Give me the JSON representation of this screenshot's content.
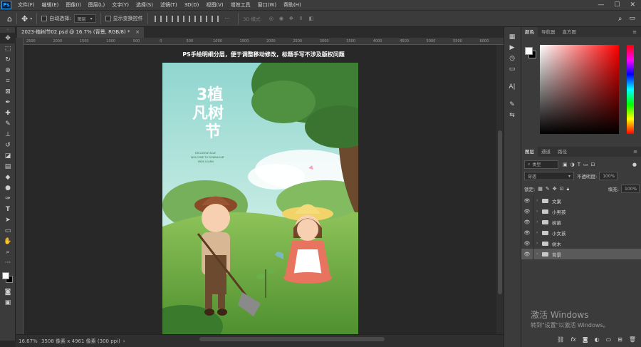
{
  "app": {
    "logo": "Ps"
  },
  "menu": [
    "文件(F)",
    "编辑(E)",
    "图像(I)",
    "图层(L)",
    "文字(Y)",
    "选择(S)",
    "滤镜(T)",
    "3D(D)",
    "视图(V)",
    "增效工具",
    "窗口(W)",
    "帮助(H)"
  ],
  "window_controls": {
    "minimize": "—",
    "maximize": "☐",
    "close": "✕"
  },
  "options_bar": {
    "auto_select_label": "自动选择:",
    "auto_select_value": "图层",
    "show_transform_label": "显示变换控件",
    "mode_3d_label": "3D 模式:"
  },
  "document_tab": {
    "title": "2023-植树节02.psd @ 16.7% (背景, RGB/8) *",
    "close": "×"
  },
  "ruler": {
    "top_ticks": [
      "2500",
      "2000",
      "1500",
      "1000",
      "500",
      "0",
      "500",
      "1000",
      "1500",
      "2000",
      "2500",
      "3000",
      "3500",
      "4000",
      "4500",
      "5000",
      "5500",
      "6000"
    ]
  },
  "canvas": {
    "caption": "PS手绘明细分层，便于调整移动修改，标题手写不涉及版权问题",
    "art_title_line1": "3植",
    "art_title_line2": "凡树",
    "art_title_line3": "节",
    "art_sub1": "EXCLUSIVE SALE",
    "art_sub2": "WELCOME TO DOWNLOAD",
    "art_sub3": "MIDS LEARN"
  },
  "status": {
    "zoom": "16.67%",
    "doc_info": "3508 像素 x 4961 像素 (300 ppi)",
    "arrow": "›"
  },
  "color_panel": {
    "tabs": [
      "颜色",
      "导航器",
      "直方图"
    ],
    "foreground": "#ffffff",
    "background": "#000000",
    "hue_color": "#ff0000"
  },
  "layers_panel": {
    "tabs": [
      "图层",
      "通道",
      "路径"
    ],
    "filter_label": "类型",
    "blend_mode": "穿透",
    "opacity_label": "不透明度:",
    "opacity_value": "100%",
    "lock_label": "锁定:",
    "fill_label": "填充:",
    "fill_value": "100%",
    "layers": [
      {
        "name": "文案",
        "selected": false
      },
      {
        "name": "小男孩",
        "selected": false
      },
      {
        "name": "树苗",
        "selected": false
      },
      {
        "name": "小女孩",
        "selected": false
      },
      {
        "name": "树木",
        "selected": false
      },
      {
        "name": "背景",
        "selected": true
      }
    ],
    "footer_icons": [
      "link-icon",
      "fx-icon",
      "mask-icon",
      "adjustment-icon",
      "group-icon",
      "new-layer-icon",
      "trash-icon"
    ],
    "footer_fx": "fx"
  },
  "watermark": {
    "line1": "激活 Windows",
    "line2": "转到\"设置\"以激活 Windows。"
  }
}
